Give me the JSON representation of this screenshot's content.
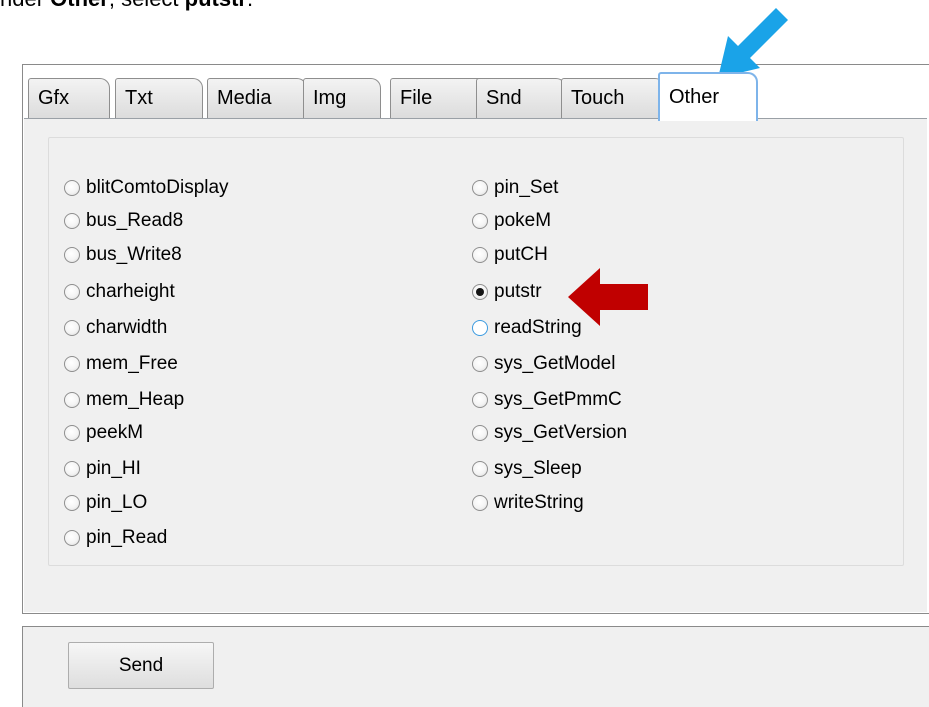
{
  "instruction": {
    "prefix": "nder ",
    "tab_word": "Other",
    "middle": ", select ",
    "item_word": "putstr",
    "suffix": "."
  },
  "tabs": [
    {
      "label": "Gfx",
      "active": false
    },
    {
      "label": "Txt",
      "active": false
    },
    {
      "label": "Media",
      "active": false
    },
    {
      "label": "Img",
      "active": false
    },
    {
      "label": "File",
      "active": false
    },
    {
      "label": "Snd",
      "active": false
    },
    {
      "label": "Touch",
      "active": false
    },
    {
      "label": "Other",
      "active": true
    }
  ],
  "options_left": [
    {
      "label": "blitComtoDisplay",
      "selected": false
    },
    {
      "label": "bus_Read8",
      "selected": false
    },
    {
      "label": "bus_Write8",
      "selected": false
    },
    {
      "label": "charheight",
      "selected": false
    },
    {
      "label": "charwidth",
      "selected": false
    },
    {
      "label": "mem_Free",
      "selected": false
    },
    {
      "label": "mem_Heap",
      "selected": false
    },
    {
      "label": "peekM",
      "selected": false
    },
    {
      "label": "pin_HI",
      "selected": false
    },
    {
      "label": "pin_LO",
      "selected": false
    },
    {
      "label": "pin_Read",
      "selected": false
    }
  ],
  "options_right": [
    {
      "label": "pin_Set",
      "selected": false
    },
    {
      "label": "pokeM",
      "selected": false
    },
    {
      "label": "putCH",
      "selected": false
    },
    {
      "label": "putstr",
      "selected": true
    },
    {
      "label": "readString",
      "selected": false,
      "hover": true
    },
    {
      "label": "sys_GetModel",
      "selected": false
    },
    {
      "label": "sys_GetPmmC",
      "selected": false
    },
    {
      "label": "sys_GetVersion",
      "selected": false
    },
    {
      "label": "sys_Sleep",
      "selected": false
    },
    {
      "label": "writeString",
      "selected": false
    }
  ],
  "send_button": {
    "label": "Send"
  },
  "colors": {
    "annotation_blue": "#1aa3e8",
    "annotation_red": "#c00000",
    "active_tab_border": "#7eb4ea"
  }
}
